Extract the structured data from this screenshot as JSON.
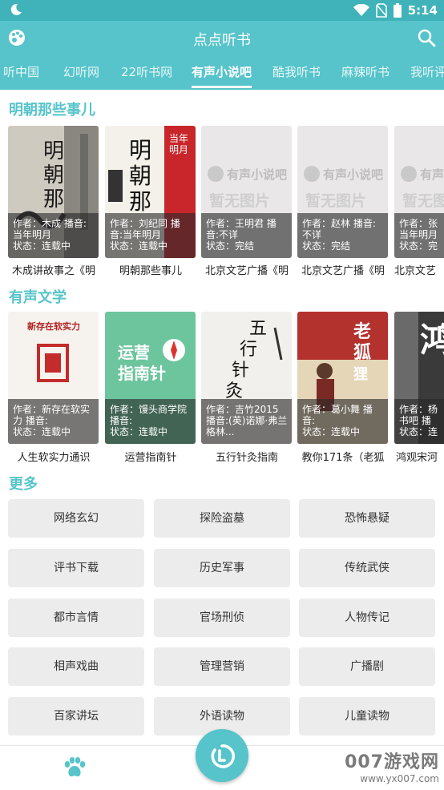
{
  "status": {
    "time": "5:14"
  },
  "appbar": {
    "title": "点点听书"
  },
  "tabs": [
    {
      "label": "听中国"
    },
    {
      "label": "幻听网"
    },
    {
      "label": "22听书网"
    },
    {
      "label": "有声小说吧"
    },
    {
      "label": "酷我听书"
    },
    {
      "label": "麻辣听书"
    },
    {
      "label": "我听评"
    }
  ],
  "sections": {
    "ming": {
      "title": "明朝那些事儿",
      "items": [
        {
          "l1": "作者：木成 播音:",
          "l2": "当年明月",
          "l3": "状态：连载中",
          "name": "木成讲故事之《明",
          "placeholder": ""
        },
        {
          "l1": "作者：刘纪同 播",
          "l2": "音:当年明月",
          "l3": "状态：连载中",
          "name": "明朝那些事儿",
          "placeholder": ""
        },
        {
          "l1": "作者：王明君 播",
          "l2": "音:不详",
          "l3": "状态：完结",
          "name": "北京文艺广播《明",
          "placeholder": "有声小说吧|暂无图片"
        },
        {
          "l1": "作者：赵林 播音:",
          "l2": "不详",
          "l3": "状态：完结",
          "name": "北京文艺广播《明",
          "placeholder": "有声小说吧|暂无图片"
        },
        {
          "l1": "作者：张",
          "l2": "当年明月",
          "l3": "状态：完",
          "name": "北京文艺",
          "placeholder": "有声小说吧|暂无图片"
        }
      ]
    },
    "wenxue": {
      "title": "有声文学",
      "items": [
        {
          "l1": "作者：新存在软实",
          "l2": "力 播音:",
          "l3": "状态：连载中",
          "name": "人生软实力通识"
        },
        {
          "l1": "作者：馒头商学院",
          "l2": "播音:",
          "l3": "状态：连载中",
          "name": "运营指南针"
        },
        {
          "l1": "作者：吉竹2015",
          "l2": "播音:(英)诺娜·弗兰",
          "l3": "格林...",
          "name": "五行针灸指南"
        },
        {
          "l1": "作者：葛小舞 播",
          "l2": "音:",
          "l3": "状态：连载中",
          "name": "教你171条（老狐"
        },
        {
          "l1": "作者：杨",
          "l2": "书吧 播",
          "l3": "状态：连",
          "name": "鸿观宋河"
        }
      ]
    },
    "more": {
      "title": "更多",
      "items": [
        "网络玄幻",
        "探险盗墓",
        "恐怖悬疑",
        "评书下载",
        "历史军事",
        "传统武侠",
        "都市言情",
        "官场刑侦",
        "人物传记",
        "相声戏曲",
        "管理营销",
        "广播剧",
        "百家讲坛",
        "外语读物",
        "儿童读物"
      ]
    }
  },
  "covers": {
    "wenxue0_text": "新存在软实力",
    "wenxue1_text": "运营|指南针",
    "wenxue2_text": "五行针灸",
    "wenxue3_text": "老狐狸经"
  },
  "watermark": {
    "big": "007游戏网",
    "small": "www.yx007.com"
  },
  "colors": {
    "accent": "#56c4ca",
    "statusbar": "#3fb3b9"
  }
}
